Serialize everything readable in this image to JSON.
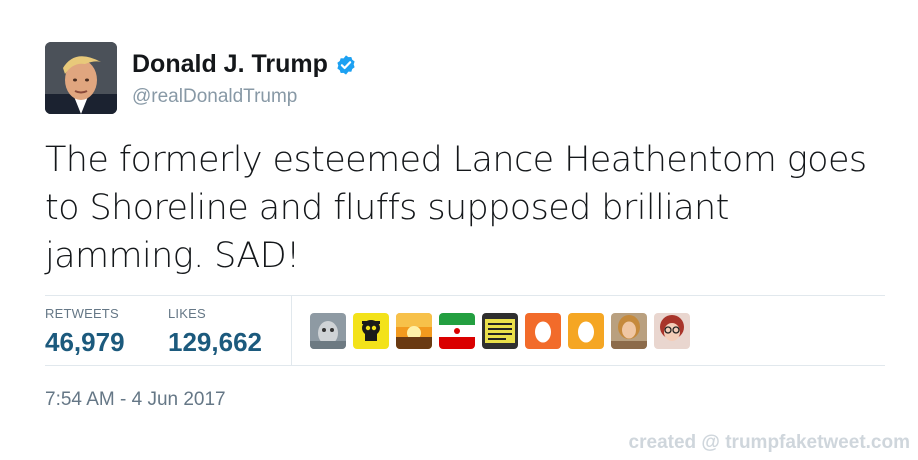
{
  "author": {
    "name": "Donald J. Trump",
    "handle": "@realDonaldTrump",
    "verified": true,
    "avatar_icon": "profile-photo-icon"
  },
  "tweet": {
    "text": "The formerly esteemed Lance Heathentom goes to Shoreline and fluffs supposed brilliant jamming. SAD!"
  },
  "stats": {
    "retweets_label": "RETWEETS",
    "retweets_value": "46,979",
    "likes_label": "LIKES",
    "likes_value": "129,662"
  },
  "liker_avatars": [
    {
      "icon": "dog-photo-icon"
    },
    {
      "icon": "yellow-skull-icon"
    },
    {
      "icon": "sunset-photo-icon"
    },
    {
      "icon": "iran-flag-icon"
    },
    {
      "icon": "protest-sign-icon"
    },
    {
      "icon": "default-egg-orange-icon"
    },
    {
      "icon": "default-egg-yellow-icon"
    },
    {
      "icon": "woman-photo-icon"
    },
    {
      "icon": "woman-glasses-photo-icon"
    }
  ],
  "timestamp": "7:54 AM - 4 Jun 2017",
  "watermark": "created @ trumpfaketweet.com",
  "colors": {
    "verified_blue": "#1da1f2",
    "stat_value": "#1c5a7d",
    "muted": "#657786"
  }
}
